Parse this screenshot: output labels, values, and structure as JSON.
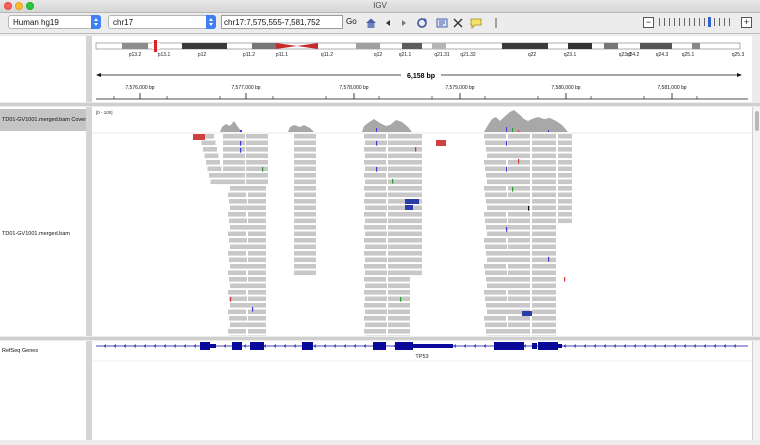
{
  "window": {
    "title": "IGV"
  },
  "toolbar": {
    "genome": "Human hg19",
    "chromosome": "chr17",
    "locus": "chr17:7,575,555-7,581,752",
    "go_label": "Go",
    "icons": [
      "home-icon",
      "back-icon",
      "forward-icon",
      "refresh-icon",
      "roi-icon",
      "resize-icon",
      "popup-text-icon",
      "ruler-line-icon"
    ]
  },
  "ideogram": {
    "bands": [
      "p13.2",
      "p13.1",
      "p12",
      "p11.2",
      "p11.1",
      "q11.2",
      "q12",
      "q21.1",
      "q21.31",
      "q21.32",
      "q22",
      "q23.1",
      "q23.3",
      "q24.2",
      "q24.3",
      "q25.1",
      "q25.3"
    ]
  },
  "ruler": {
    "span_label": "6,158 bp",
    "ticks": [
      "7,576,000 bp",
      "7,577,000 bp",
      "7,578,000 bp",
      "7,579,000 bp",
      "7,580,000 bp",
      "7,581,000 bp"
    ]
  },
  "tracks": {
    "coverage_label": "TD01-GV1001.merged.bam Coverage",
    "coverage_range": "[0 - 100]",
    "alignment_label": "TD01-GV1001.merged.bam",
    "genes_label": "RefSeq Genes",
    "gene_name": "TP53"
  },
  "colors": {
    "read": "#c8c8c8",
    "gene": "#0a0a9a",
    "coverage": "#a8a8a8",
    "centromere": "#c62b2b",
    "accent": "#3e7ef6"
  }
}
